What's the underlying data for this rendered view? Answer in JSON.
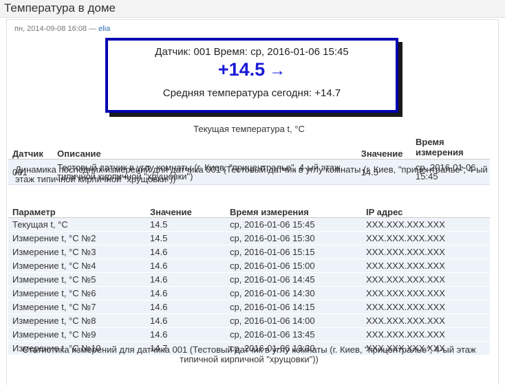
{
  "page": {
    "title": "Температура в доме"
  },
  "meta": {
    "date": "пн, 2014-09-08 16:08",
    "separator": " — ",
    "author": "elia"
  },
  "current": {
    "line1": "Датчик: 001 Время: ср, 2016-01-06 15:45",
    "temperature": "+14.5",
    "trend_arrow": "→",
    "line3": "Средняя температура сегодня: +14.7",
    "accent": "#1a1ad8",
    "frame": "#0000b0"
  },
  "table1": {
    "caption": "Текущая температура t, °С",
    "headers": [
      "Датчик",
      "Описание",
      "Значение",
      "Время измерения"
    ],
    "rows": [
      [
        "001",
        "Тестовый датчик в углу комнаты (г. Киев, \"прицентралье\", 4-ый этаж типичной кирпичной \"хрущовки\")",
        "14.5",
        "ср, 2016-01-06 15:45"
      ]
    ]
  },
  "table2": {
    "caption": "Динамика последних измерений для датчика 001 (Тестовый датчик в углу комнаты (г. Киев, \"прицентралье\", 4-ый этаж типичной кирпичной \"хрущовки\"))",
    "headers": [
      "Параметр",
      "Значение",
      "Время измерения",
      "IP адрес"
    ],
    "rows": [
      [
        "Текущая t, °С",
        "14.5",
        "ср, 2016-01-06 15:45",
        "XXX.XXX.XXX.XXX"
      ],
      [
        "Измерение t, °С №2",
        "14.5",
        "ср, 2016-01-06 15:30",
        "XXX.XXX.XXX.XXX"
      ],
      [
        "Измерение t, °С №3",
        "14.6",
        "ср, 2016-01-06 15:15",
        "XXX.XXX.XXX.XXX"
      ],
      [
        "Измерение t, °С №4",
        "14.6",
        "ср, 2016-01-06 15:00",
        "XXX.XXX.XXX.XXX"
      ],
      [
        "Измерение t, °С №5",
        "14.6",
        "ср, 2016-01-06 14:45",
        "XXX.XXX.XXX.XXX"
      ],
      [
        "Измерение t, °С №6",
        "14.6",
        "ср, 2016-01-06 14:30",
        "XXX.XXX.XXX.XXX"
      ],
      [
        "Измерение t, °С №7",
        "14.6",
        "ср, 2016-01-06 14:15",
        "XXX.XXX.XXX.XXX"
      ],
      [
        "Измерение t, °С №8",
        "14.6",
        "ср, 2016-01-06 14:00",
        "XXX.XXX.XXX.XXX"
      ],
      [
        "Измерение t, °С №9",
        "14.6",
        "ср, 2016-01-06 13:45",
        "XXX.XXX.XXX.XXX"
      ],
      [
        "Измерение t, °С №10",
        "14.7",
        "ср, 2016-01-06 13:30",
        "XXX.XXX.XXX.XXX"
      ]
    ]
  },
  "stats": {
    "caption": "Статистика измерений для датчика 001 (Тестовый датчик в углу комнаты (г. Киев, \"прицентралье\", 4-ый этаж типичной кирпичной \"хрущовки\"))"
  }
}
